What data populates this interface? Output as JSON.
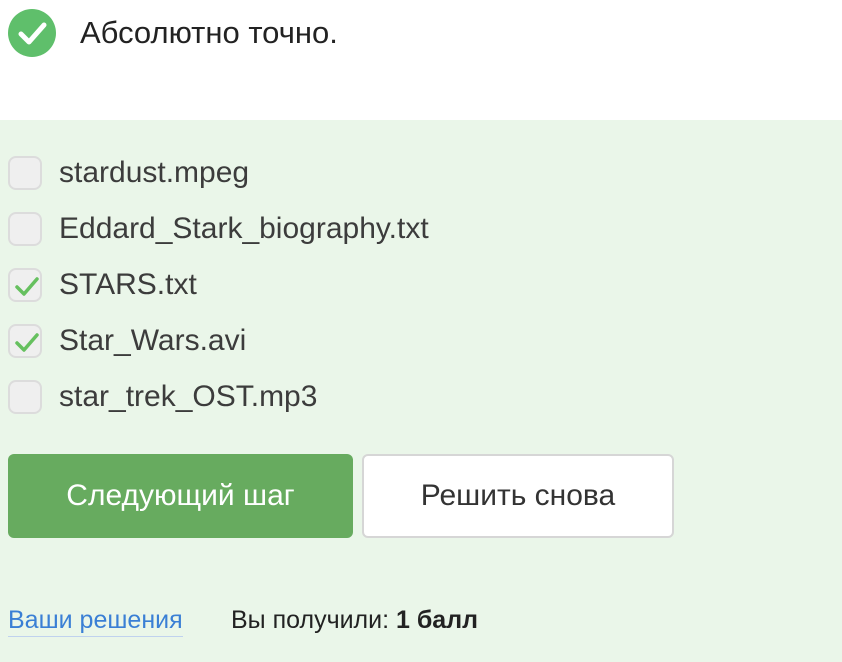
{
  "colors": {
    "success": "#5fbf6b",
    "panel_bg": "#eaf6e9",
    "primary": "#67ab5f",
    "link": "#3a7fd5",
    "checkmark": "#66c05f"
  },
  "status": {
    "icon": "check-circle-icon",
    "text": "Абсолютно точно."
  },
  "options": [
    {
      "label": "stardust.mpeg",
      "checked": false
    },
    {
      "label": "Eddard_Stark_biography.txt",
      "checked": false
    },
    {
      "label": "STARS.txt",
      "checked": true
    },
    {
      "label": "Star_Wars.avi",
      "checked": true
    },
    {
      "label": "star_trek_OST.mp3",
      "checked": false
    }
  ],
  "actions": {
    "next_label": "Следующий шаг",
    "retry_label": "Решить снова"
  },
  "footer": {
    "solutions_link": "Ваши решения",
    "score_prefix": "Вы получили:",
    "score_value": "1 балл"
  }
}
